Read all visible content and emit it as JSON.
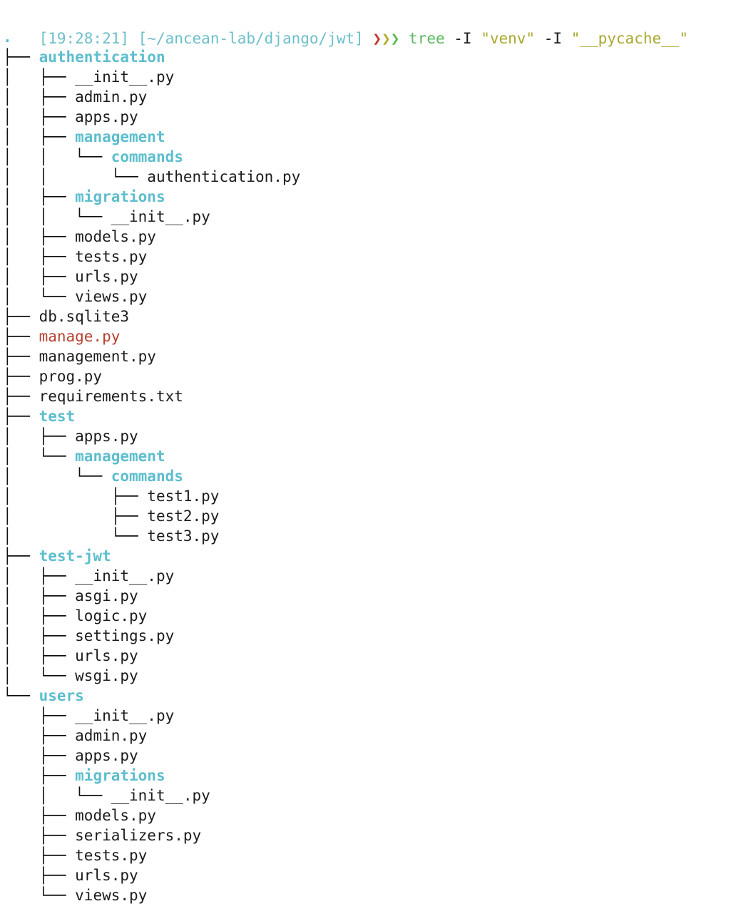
{
  "terminal": {
    "background_color": "#ffffff",
    "prompt": {
      "timestamp": "[19:28:21]",
      "path": "[~/ancean-lab/django/jwt]",
      "chevrons": [
        "❯",
        "❯",
        "❯"
      ],
      "chevron_colors": [
        "#c0392b",
        "#b0ad2c",
        "#57bb54"
      ],
      "command_name": "tree",
      "command_args": [
        {
          "text": "-I",
          "kind": "flag"
        },
        {
          "text": "\"venv\"",
          "kind": "string"
        },
        {
          "text": "-I",
          "kind": "flag"
        },
        {
          "text": "\"__pycache__\"",
          "kind": "string"
        }
      ],
      "full_command": "tree -I \"venv\" -I \"__pycache__\"",
      "colors": {
        "timestamp": "#6cbfca",
        "path": "#6cbfca",
        "command": "#5cb85c",
        "flag": "#1c1c1c",
        "string": "#a9a82f"
      }
    },
    "tree": {
      "root": ".",
      "root_kind": "dir",
      "colors": {
        "dir": "#5dbecd",
        "file": "#1c1c1c",
        "exec": "#b5412f",
        "branch": "#111111"
      },
      "lines": [
        {
          "prefix": "",
          "connector": "",
          "name": ".",
          "kind": "dir-root"
        },
        {
          "prefix": "",
          "connector": "├── ",
          "name": "authentication",
          "kind": "dir"
        },
        {
          "prefix": "│   ",
          "connector": "├── ",
          "name": "__init__.py",
          "kind": "file"
        },
        {
          "prefix": "│   ",
          "connector": "├── ",
          "name": "admin.py",
          "kind": "file"
        },
        {
          "prefix": "│   ",
          "connector": "├── ",
          "name": "apps.py",
          "kind": "file"
        },
        {
          "prefix": "│   ",
          "connector": "├── ",
          "name": "management",
          "kind": "dir"
        },
        {
          "prefix": "│   │   ",
          "connector": "└── ",
          "name": "commands",
          "kind": "dir"
        },
        {
          "prefix": "│   │       ",
          "connector": "└── ",
          "name": "authentication.py",
          "kind": "file"
        },
        {
          "prefix": "│   ",
          "connector": "├── ",
          "name": "migrations",
          "kind": "dir"
        },
        {
          "prefix": "│   │   ",
          "connector": "└── ",
          "name": "__init__.py",
          "kind": "file"
        },
        {
          "prefix": "│   ",
          "connector": "├── ",
          "name": "models.py",
          "kind": "file"
        },
        {
          "prefix": "│   ",
          "connector": "├── ",
          "name": "tests.py",
          "kind": "file"
        },
        {
          "prefix": "│   ",
          "connector": "├── ",
          "name": "urls.py",
          "kind": "file"
        },
        {
          "prefix": "│   ",
          "connector": "└── ",
          "name": "views.py",
          "kind": "file"
        },
        {
          "prefix": "",
          "connector": "├── ",
          "name": "db.sqlite3",
          "kind": "file"
        },
        {
          "prefix": "",
          "connector": "├── ",
          "name": "manage.py",
          "kind": "exec"
        },
        {
          "prefix": "",
          "connector": "├── ",
          "name": "management.py",
          "kind": "file"
        },
        {
          "prefix": "",
          "connector": "├── ",
          "name": "prog.py",
          "kind": "file"
        },
        {
          "prefix": "",
          "connector": "├── ",
          "name": "requirements.txt",
          "kind": "file"
        },
        {
          "prefix": "",
          "connector": "├── ",
          "name": "test",
          "kind": "dir"
        },
        {
          "prefix": "│   ",
          "connector": "├── ",
          "name": "apps.py",
          "kind": "file"
        },
        {
          "prefix": "│   ",
          "connector": "└── ",
          "name": "management",
          "kind": "dir"
        },
        {
          "prefix": "│       ",
          "connector": "└── ",
          "name": "commands",
          "kind": "dir"
        },
        {
          "prefix": "│           ",
          "connector": "├── ",
          "name": "test1.py",
          "kind": "file"
        },
        {
          "prefix": "│           ",
          "connector": "├── ",
          "name": "test2.py",
          "kind": "file"
        },
        {
          "prefix": "│           ",
          "connector": "└── ",
          "name": "test3.py",
          "kind": "file"
        },
        {
          "prefix": "",
          "connector": "├── ",
          "name": "test-jwt",
          "kind": "dir"
        },
        {
          "prefix": "│   ",
          "connector": "├── ",
          "name": "__init__.py",
          "kind": "file"
        },
        {
          "prefix": "│   ",
          "connector": "├── ",
          "name": "asgi.py",
          "kind": "file"
        },
        {
          "prefix": "│   ",
          "connector": "├── ",
          "name": "logic.py",
          "kind": "file"
        },
        {
          "prefix": "│   ",
          "connector": "├── ",
          "name": "settings.py",
          "kind": "file"
        },
        {
          "prefix": "│   ",
          "connector": "├── ",
          "name": "urls.py",
          "kind": "file"
        },
        {
          "prefix": "│   ",
          "connector": "└── ",
          "name": "wsgi.py",
          "kind": "file"
        },
        {
          "prefix": "",
          "connector": "└── ",
          "name": "users",
          "kind": "dir"
        },
        {
          "prefix": "    ",
          "connector": "├── ",
          "name": "__init__.py",
          "kind": "file"
        },
        {
          "prefix": "    ",
          "connector": "├── ",
          "name": "admin.py",
          "kind": "file"
        },
        {
          "prefix": "    ",
          "connector": "├── ",
          "name": "apps.py",
          "kind": "file"
        },
        {
          "prefix": "    ",
          "connector": "├── ",
          "name": "migrations",
          "kind": "dir"
        },
        {
          "prefix": "    │   ",
          "connector": "└── ",
          "name": "__init__.py",
          "kind": "file"
        },
        {
          "prefix": "    ",
          "connector": "├── ",
          "name": "models.py",
          "kind": "file"
        },
        {
          "prefix": "    ",
          "connector": "├── ",
          "name": "serializers.py",
          "kind": "file"
        },
        {
          "prefix": "    ",
          "connector": "├── ",
          "name": "tests.py",
          "kind": "file"
        },
        {
          "prefix": "    ",
          "connector": "├── ",
          "name": "urls.py",
          "kind": "file"
        },
        {
          "prefix": "    ",
          "connector": "└── ",
          "name": "views.py",
          "kind": "file"
        }
      ]
    }
  }
}
